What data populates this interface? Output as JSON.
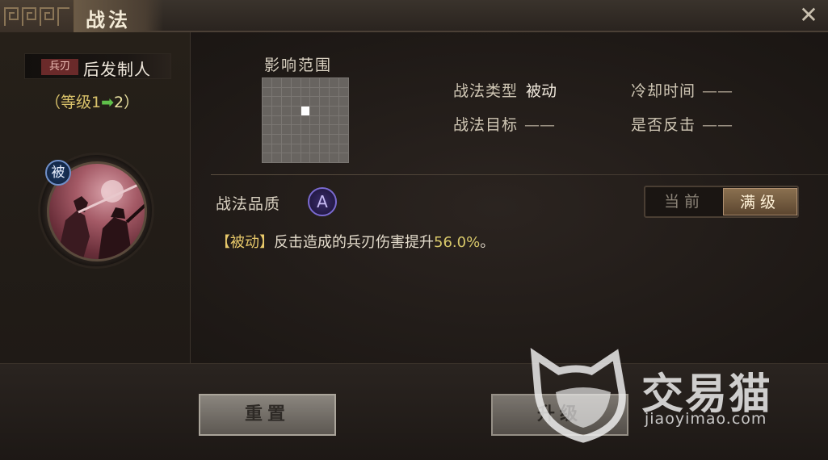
{
  "window": {
    "title": "战法",
    "close_icon": "close-icon"
  },
  "skill": {
    "type_tag": "兵刃",
    "name": "后发制人",
    "level_prefix": "（等级1",
    "level_arrow": "➡",
    "level_suffix": "2）",
    "passive_badge": "被"
  },
  "range": {
    "label": "影响范围",
    "size": 9
  },
  "info": {
    "type_label": "战法类型",
    "type_value": "被动",
    "target_label": "战法目标",
    "target_value": "——",
    "cooldown_label": "冷却时间",
    "cooldown_value": "——",
    "counter_label": "是否反击",
    "counter_value": "——"
  },
  "quality": {
    "label": "战法品质",
    "grade": "A"
  },
  "toggle": {
    "current": "当前",
    "max": "满级",
    "selected": "max"
  },
  "description": {
    "tag": "【被动】",
    "text": "反击造成的兵刃伤害提升",
    "value": "56.0%",
    "end": "。"
  },
  "buttons": {
    "reset": "重置",
    "upgrade": "升级"
  },
  "watermark": {
    "brand": "交易猫",
    "url": "jiaoyimao.com"
  },
  "colors": {
    "accent_gold": "#d9c26a",
    "arrow_green": "#5fc04a",
    "quality_purple": "#7a6ad0",
    "passive_blue": "#6f8fc8"
  }
}
